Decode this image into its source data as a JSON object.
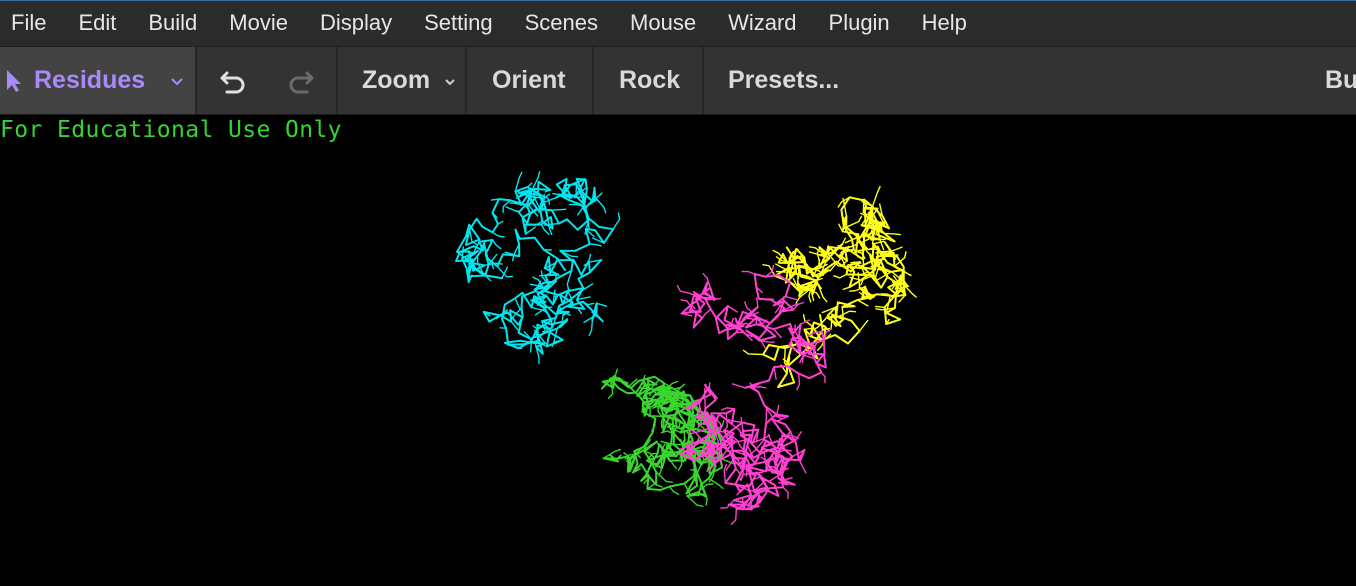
{
  "menubar": {
    "items": [
      {
        "label": "File"
      },
      {
        "label": "Edit"
      },
      {
        "label": "Build"
      },
      {
        "label": "Movie"
      },
      {
        "label": "Display"
      },
      {
        "label": "Setting"
      },
      {
        "label": "Scenes"
      },
      {
        "label": "Mouse"
      },
      {
        "label": "Wizard"
      },
      {
        "label": "Plugin"
      },
      {
        "label": "Help"
      }
    ]
  },
  "toolbar": {
    "mode_label": "Residues",
    "mode_icon": "pointer-arrow-icon",
    "undo_icon": "undo-icon",
    "redo_icon": "redo-icon",
    "zoom_label": "Zoom",
    "orient_label": "Orient",
    "rock_label": "Rock",
    "presets_label": "Presets...",
    "build_label_truncated": "Bu",
    "accent_color": "#a78bfa"
  },
  "viewport": {
    "watermark": "For Educational Use Only",
    "background": "#000000",
    "chain_colors": [
      "#00e5ee",
      "#ff40d0",
      "#ffff1a",
      "#39d62e"
    ]
  }
}
